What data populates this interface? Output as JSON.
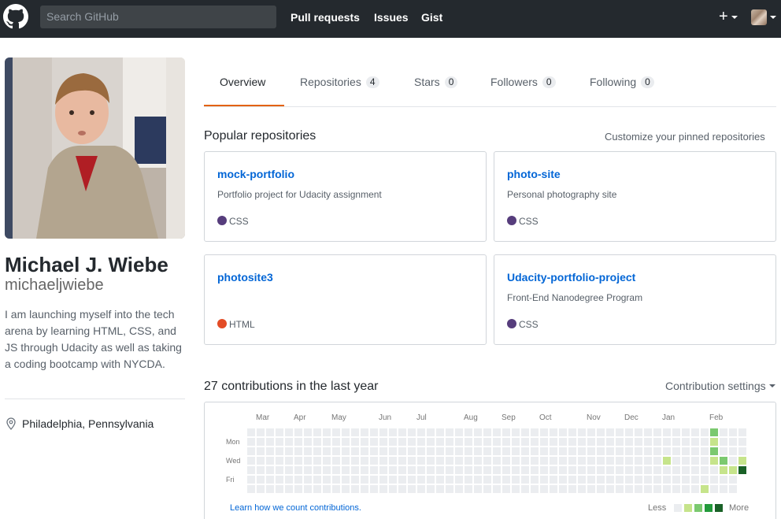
{
  "header": {
    "search_placeholder": "Search GitHub",
    "nav": [
      "Pull requests",
      "Issues",
      "Gist"
    ],
    "plus_label": "+"
  },
  "profile": {
    "fullname": "Michael J. Wiebe",
    "username": "michaeljwiebe",
    "bio": "I am launching myself into the tech arena by learning HTML, CSS, and JS through Udacity as well as taking a coding bootcamp with NYCDA.",
    "location": "Philadelphia, Pennsylvania"
  },
  "tabs": [
    {
      "label": "Overview",
      "count": null,
      "active": true
    },
    {
      "label": "Repositories",
      "count": "4"
    },
    {
      "label": "Stars",
      "count": "0"
    },
    {
      "label": "Followers",
      "count": "0"
    },
    {
      "label": "Following",
      "count": "0"
    }
  ],
  "popular": {
    "title": "Popular repositories",
    "customize_link": "Customize your pinned repositories",
    "repos": [
      {
        "name": "mock-portfolio",
        "description": "Portfolio project for Udacity assignment",
        "language": "CSS",
        "color": "#563d7c"
      },
      {
        "name": "photo-site",
        "description": "Personal photography site",
        "language": "CSS",
        "color": "#563d7c"
      },
      {
        "name": "photosite3",
        "description": "",
        "language": "HTML",
        "color": "#e34c26"
      },
      {
        "name": "Udacity-portfolio-project",
        "description": "Front-End Nanodegree Program",
        "language": "CSS",
        "color": "#563d7c"
      }
    ]
  },
  "contributions": {
    "title": "27 contributions in the last year",
    "settings": "Contribution settings",
    "months": [
      "Mar",
      "Apr",
      "May",
      "Jun",
      "Jul",
      "Aug",
      "Sep",
      "Oct",
      "Nov",
      "Dec",
      "Jan",
      "Feb"
    ],
    "days": [
      "Mon",
      "Wed",
      "Fri"
    ],
    "learn_link": "Learn how we count contributions.",
    "legend_less": "Less",
    "legend_more": "More",
    "colors": [
      "#ebedf0",
      "#c6e48b",
      "#7bc96f",
      "#239a3b",
      "#196127"
    ],
    "active_days": [
      {
        "week": 49,
        "day": 0,
        "level": 2
      },
      {
        "week": 49,
        "day": 1,
        "level": 1
      },
      {
        "week": 49,
        "day": 2,
        "level": 2
      },
      {
        "week": 49,
        "day": 3,
        "level": 1
      },
      {
        "week": 44,
        "day": 3,
        "level": 1
      },
      {
        "week": 50,
        "day": 3,
        "level": 2
      },
      {
        "week": 52,
        "day": 3,
        "level": 1
      },
      {
        "week": 50,
        "day": 4,
        "level": 1
      },
      {
        "week": 51,
        "day": 4,
        "level": 1
      },
      {
        "week": 52,
        "day": 4,
        "level": 4
      },
      {
        "week": 48,
        "day": 6,
        "level": 1
      }
    ]
  }
}
